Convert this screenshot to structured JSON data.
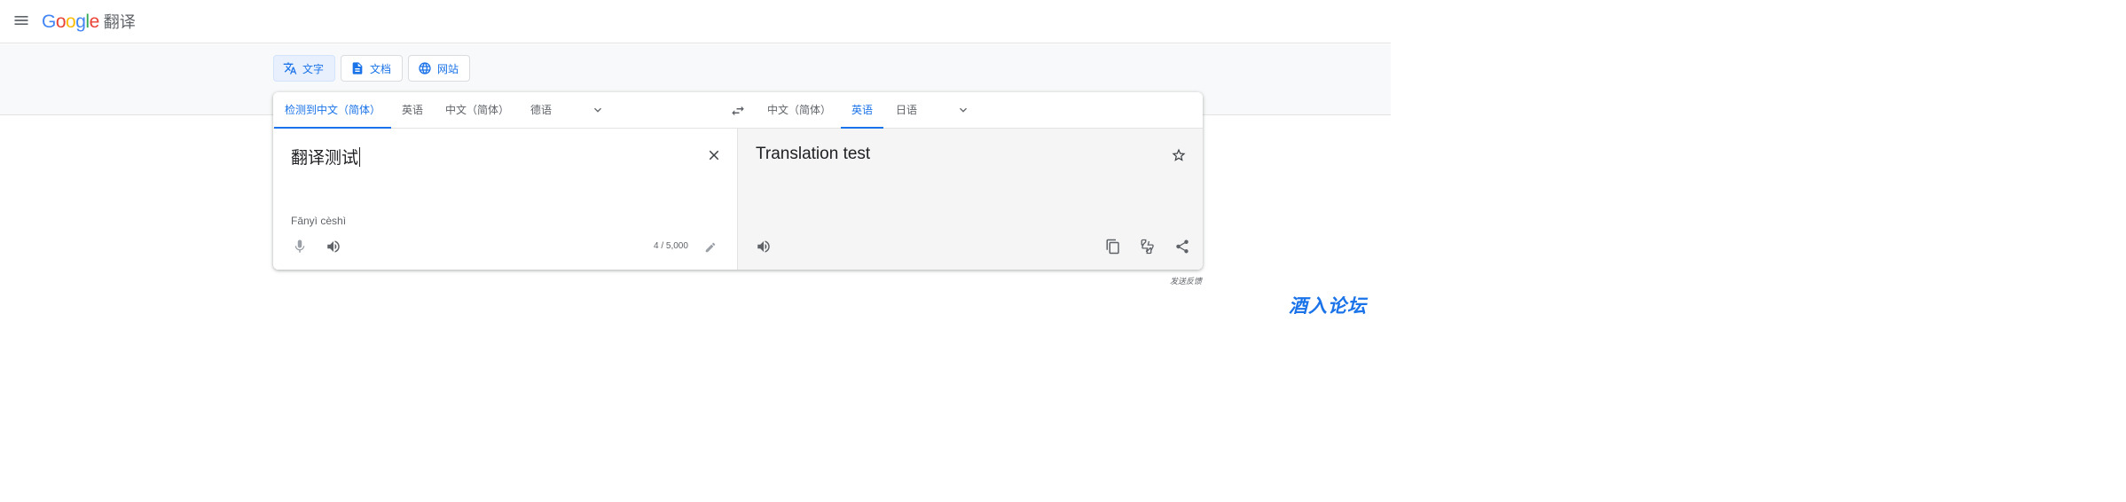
{
  "header": {
    "logo_letters": [
      {
        "ch": "G",
        "color": "#4285f4"
      },
      {
        "ch": "o",
        "color": "#ea4335"
      },
      {
        "ch": "o",
        "color": "#fbbc05"
      },
      {
        "ch": "g",
        "color": "#4285f4"
      },
      {
        "ch": "l",
        "color": "#34a853"
      },
      {
        "ch": "e",
        "color": "#ea4335"
      }
    ],
    "product": "翻译",
    "menu_icon": "hamburger-menu-icon"
  },
  "mode_tabs": [
    {
      "label": "文字",
      "icon": "translate-icon",
      "active": true
    },
    {
      "label": "文档",
      "icon": "document-icon",
      "active": false
    },
    {
      "label": "网站",
      "icon": "globe-icon",
      "active": false
    }
  ],
  "source_langs": [
    {
      "label": "检测到中文（简体）",
      "active": true
    },
    {
      "label": "英语",
      "active": false
    },
    {
      "label": "中文（简体）",
      "active": false
    },
    {
      "label": "德语",
      "active": false
    }
  ],
  "target_langs": [
    {
      "label": "中文（简体）",
      "active": false
    },
    {
      "label": "英语",
      "active": true
    },
    {
      "label": "日语",
      "active": false
    }
  ],
  "source": {
    "text": "翻译测试",
    "romanization": "Fānyì cèshì",
    "char_count": "4 / 5,000"
  },
  "target": {
    "text": "Translation test"
  },
  "feedback_link": "发送反馈",
  "watermark": "酒入论坛",
  "colors": {
    "accent": "#1a73e8",
    "icon_gray": "#5f6368",
    "disabled_gray": "#9aa0a6",
    "target_bg": "#f5f5f5"
  }
}
